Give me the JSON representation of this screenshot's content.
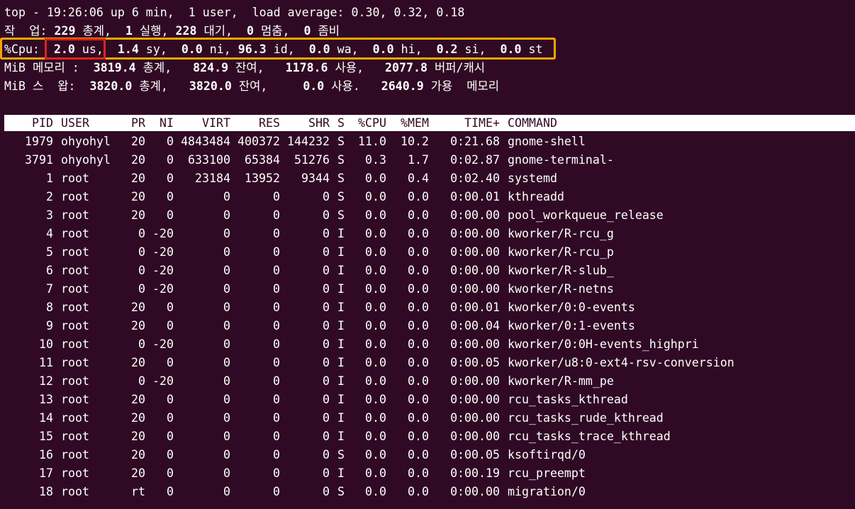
{
  "summary": {
    "line1": "top - 19:26:06 up 6 min,  1 user,  load average: 0.30, 0.32, 0.18",
    "tasks": {
      "label": "작  업: ",
      "total": "229",
      "total_label": " 총계,  ",
      "running": "1",
      "running_label": " 실행, ",
      "sleeping": "228",
      "sleeping_label": " 대기,  ",
      "stopped": "0",
      "stopped_label": " 멈춤,  ",
      "zombie": "0",
      "zombie_label": " 좀비"
    },
    "cpu": {
      "label": "%Cpu:",
      "us": "2.0",
      "us_label": " us,",
      "sy": "1.4",
      "sy_label": " sy,",
      "ni": "0.0",
      "ni_label": " ni,",
      "id": "96.3",
      "id_label": " id,",
      "wa": "0.0",
      "wa_label": " wa,",
      "hi": "0.0",
      "hi_label": " hi,",
      "si": "0.2",
      "si_label": " si,",
      "st": "0.0",
      "st_label": " st"
    },
    "mem": {
      "label": "MiB 메모리 :  ",
      "total": "3819.4",
      "total_label": " 총계,   ",
      "free": "824.9",
      "free_label": " 잔여,   ",
      "used": "1178.6",
      "used_label": " 사용,   ",
      "buff": "2077.8",
      "buff_label": " 버퍼/캐시"
    },
    "swap": {
      "label": "MiB 스  왑:  ",
      "total": "3820.0",
      "total_label": " 총계,   ",
      "free": "3820.0",
      "free_label": " 잔여,     ",
      "used": "0.0",
      "used_label": " 사용.   ",
      "avail": "2640.9",
      "avail_label": " 가용  메모리"
    }
  },
  "columns": [
    "PID",
    "USER",
    "PR",
    "NI",
    "VIRT",
    "RES",
    "SHR",
    "S",
    "%CPU",
    "%MEM",
    "TIME+",
    "COMMAND"
  ],
  "processes": [
    [
      "1979",
      "ohyohyl",
      "20",
      "0",
      "4843484",
      "400372",
      "144232",
      "S",
      "11.0",
      "10.2",
      "0:21.68",
      "gnome-shell"
    ],
    [
      "3791",
      "ohyohyl",
      "20",
      "0",
      "633100",
      "65384",
      "51276",
      "S",
      "0.3",
      "1.7",
      "0:02.87",
      "gnome-terminal-"
    ],
    [
      "1",
      "root",
      "20",
      "0",
      "23184",
      "13952",
      "9344",
      "S",
      "0.0",
      "0.4",
      "0:02.40",
      "systemd"
    ],
    [
      "2",
      "root",
      "20",
      "0",
      "0",
      "0",
      "0",
      "S",
      "0.0",
      "0.0",
      "0:00.01",
      "kthreadd"
    ],
    [
      "3",
      "root",
      "20",
      "0",
      "0",
      "0",
      "0",
      "S",
      "0.0",
      "0.0",
      "0:00.00",
      "pool_workqueue_release"
    ],
    [
      "4",
      "root",
      "0",
      "-20",
      "0",
      "0",
      "0",
      "I",
      "0.0",
      "0.0",
      "0:00.00",
      "kworker/R-rcu_g"
    ],
    [
      "5",
      "root",
      "0",
      "-20",
      "0",
      "0",
      "0",
      "I",
      "0.0",
      "0.0",
      "0:00.00",
      "kworker/R-rcu_p"
    ],
    [
      "6",
      "root",
      "0",
      "-20",
      "0",
      "0",
      "0",
      "I",
      "0.0",
      "0.0",
      "0:00.00",
      "kworker/R-slub_"
    ],
    [
      "7",
      "root",
      "0",
      "-20",
      "0",
      "0",
      "0",
      "I",
      "0.0",
      "0.0",
      "0:00.00",
      "kworker/R-netns"
    ],
    [
      "8",
      "root",
      "20",
      "0",
      "0",
      "0",
      "0",
      "I",
      "0.0",
      "0.0",
      "0:00.01",
      "kworker/0:0-events"
    ],
    [
      "9",
      "root",
      "20",
      "0",
      "0",
      "0",
      "0",
      "I",
      "0.0",
      "0.0",
      "0:00.04",
      "kworker/0:1-events"
    ],
    [
      "10",
      "root",
      "0",
      "-20",
      "0",
      "0",
      "0",
      "I",
      "0.0",
      "0.0",
      "0:00.00",
      "kworker/0:0H-events_highpri"
    ],
    [
      "11",
      "root",
      "20",
      "0",
      "0",
      "0",
      "0",
      "I",
      "0.0",
      "0.0",
      "0:00.05",
      "kworker/u8:0-ext4-rsv-conversion"
    ],
    [
      "12",
      "root",
      "0",
      "-20",
      "0",
      "0",
      "0",
      "I",
      "0.0",
      "0.0",
      "0:00.00",
      "kworker/R-mm_pe"
    ],
    [
      "13",
      "root",
      "20",
      "0",
      "0",
      "0",
      "0",
      "I",
      "0.0",
      "0.0",
      "0:00.00",
      "rcu_tasks_kthread"
    ],
    [
      "14",
      "root",
      "20",
      "0",
      "0",
      "0",
      "0",
      "I",
      "0.0",
      "0.0",
      "0:00.00",
      "rcu_tasks_rude_kthread"
    ],
    [
      "15",
      "root",
      "20",
      "0",
      "0",
      "0",
      "0",
      "I",
      "0.0",
      "0.0",
      "0:00.00",
      "rcu_tasks_trace_kthread"
    ],
    [
      "16",
      "root",
      "20",
      "0",
      "0",
      "0",
      "0",
      "S",
      "0.0",
      "0.0",
      "0:00.05",
      "ksoftirqd/0"
    ],
    [
      "17",
      "root",
      "20",
      "0",
      "0",
      "0",
      "0",
      "I",
      "0.0",
      "0.0",
      "0:00.19",
      "rcu_preempt"
    ],
    [
      "18",
      "root",
      "rt",
      "0",
      "0",
      "0",
      "0",
      "S",
      "0.0",
      "0.0",
      "0:00.00",
      "migration/0"
    ]
  ],
  "colors": {
    "background": "#300a24",
    "foreground": "#ffffff",
    "highlight_orange": "#f5a500",
    "highlight_red": "#e0231c"
  }
}
